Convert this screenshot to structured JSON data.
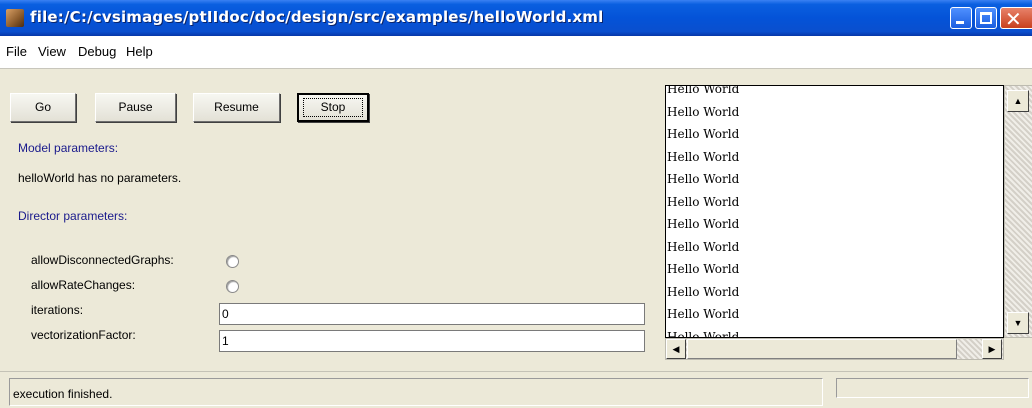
{
  "window": {
    "title": "file:/C:/cvsimages/ptIIdoc/doc/design/src/examples/helloWorld.xml",
    "minimize_glyph": "",
    "close_glyph": "✕"
  },
  "menu": [
    "File",
    "View",
    "Debug",
    "Help"
  ],
  "toolbar": {
    "go_label": "Go",
    "pause_label": "Pause",
    "resume_label": "Resume",
    "stop_label": "Stop"
  },
  "model": {
    "heading": "Model parameters:",
    "message": "helloWorld has no parameters."
  },
  "director": {
    "heading": "Director parameters:",
    "allow_disconnected_label": "allowDisconnectedGraphs:",
    "allow_disconnected_checked": false,
    "allow_rate_changes_label": "allowRateChanges:",
    "allow_rate_changes_checked": false,
    "iterations_label": "iterations:",
    "iterations_value": "0",
    "vectorization_label": "vectorizationFactor:",
    "vectorization_value": "1"
  },
  "output": {
    "lines": [
      "Hello World",
      "Hello World",
      "Hello World",
      "Hello World",
      "Hello World",
      "Hello World",
      "Hello World",
      "Hello World",
      "Hello World",
      "Hello World",
      "Hello World",
      "Hello World"
    ],
    "scroll_up_glyph": "▲",
    "scroll_down_glyph": "▼",
    "scroll_left_glyph": "◀",
    "scroll_right_glyph": "▶"
  },
  "status": {
    "message": "execution finished."
  },
  "icons": {
    "app": "ptolemy-app-icon",
    "minimize": "minimize-icon",
    "maximize": "maximize-icon",
    "close": "close-icon"
  },
  "colors": {
    "titlebar": "#0453d8",
    "heading_text": "#1a1a8c",
    "face": "#ece9d8"
  }
}
